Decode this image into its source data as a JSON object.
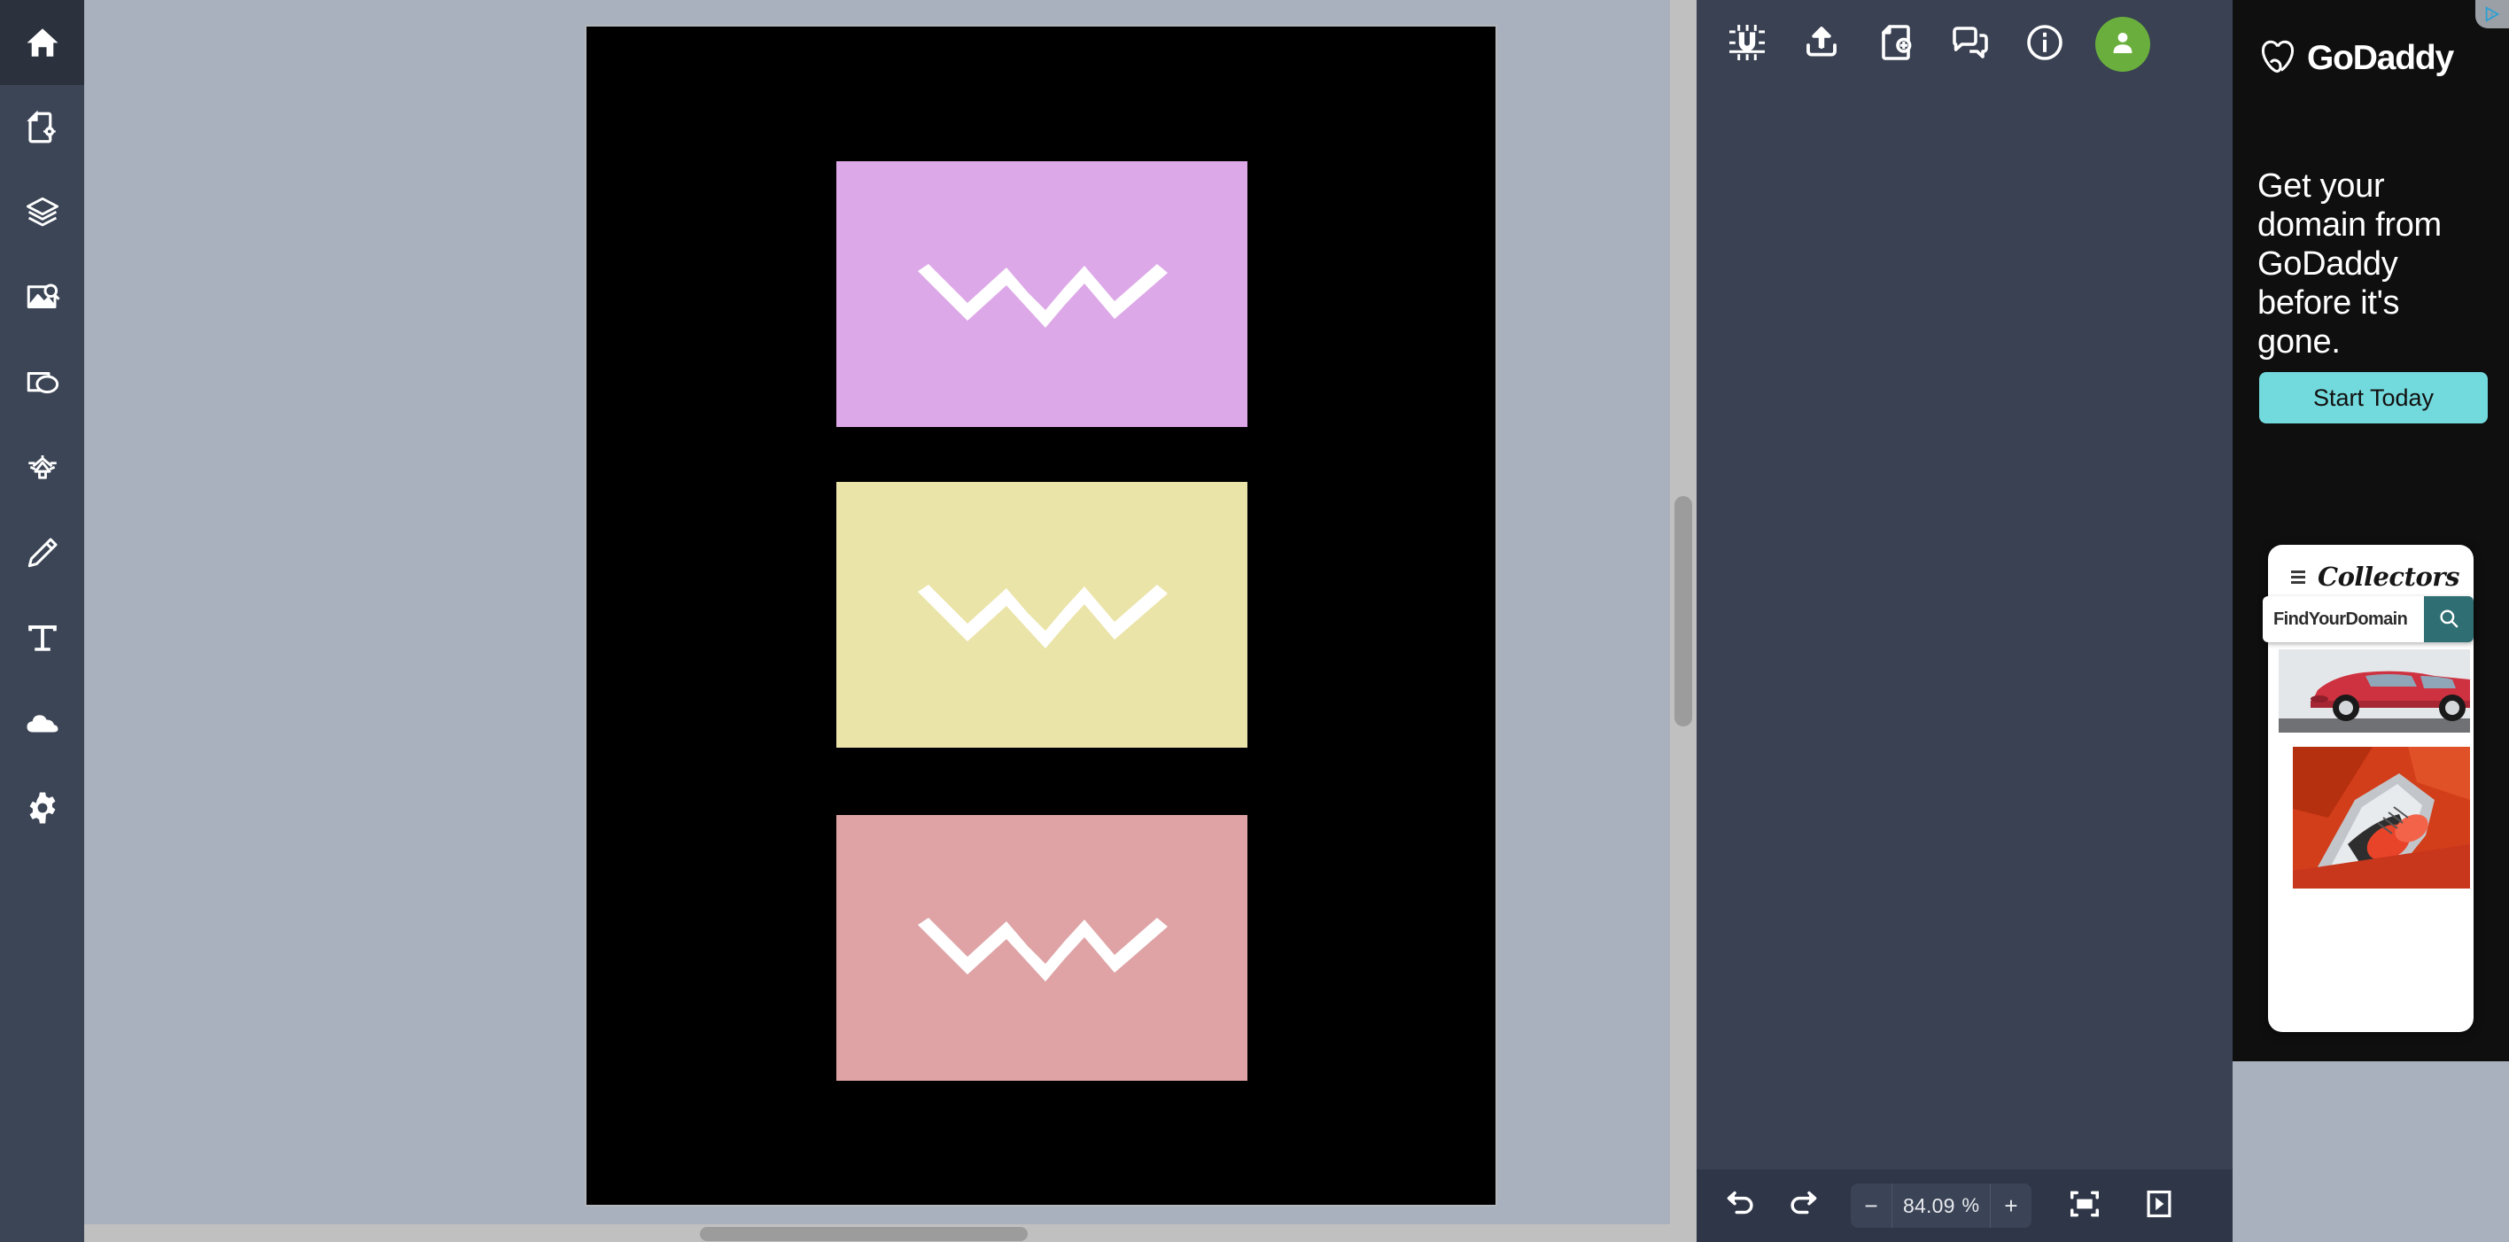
{
  "sidebar": {
    "items": [
      {
        "name": "home",
        "icon": "home-icon",
        "active": true
      },
      {
        "name": "page-setup",
        "icon": "document-settings-icon",
        "active": false
      },
      {
        "name": "layers",
        "icon": "layers-icon",
        "active": false
      },
      {
        "name": "images",
        "icon": "image-search-icon",
        "active": false
      },
      {
        "name": "shapes",
        "icon": "shapes-icon",
        "active": false
      },
      {
        "name": "drawing-tools",
        "icon": "vector-pen-icon",
        "active": false
      },
      {
        "name": "pencil",
        "icon": "pencil-icon",
        "active": false
      },
      {
        "name": "text",
        "icon": "text-tool-icon",
        "active": false
      },
      {
        "name": "uploads",
        "icon": "cloud-upload-icon",
        "active": false
      },
      {
        "name": "settings",
        "icon": "gear-icon",
        "active": false
      }
    ]
  },
  "toolbar": {
    "buttons": [
      {
        "name": "snap-to-grid",
        "icon": "magnet-grid-icon"
      },
      {
        "name": "upload",
        "icon": "upload-icon"
      },
      {
        "name": "add-page",
        "icon": "add-page-icon"
      },
      {
        "name": "comments",
        "icon": "comments-icon"
      },
      {
        "name": "info",
        "icon": "info-icon"
      }
    ],
    "avatar": {
      "name": "user-avatar",
      "icon": "person-icon",
      "color": "#6AAF3D"
    }
  },
  "bottom_bar": {
    "undo": {
      "name": "undo",
      "icon": "undo-arrow-icon"
    },
    "redo": {
      "name": "redo",
      "icon": "redo-arrow-icon"
    },
    "zoom_out_label": "−",
    "zoom_value": "84.09",
    "zoom_unit": "%",
    "zoom_in_label": "+",
    "fit_screen": {
      "name": "fit-to-screen",
      "icon": "fit-screen-icon"
    },
    "toggle_panel": {
      "name": "toggle-side-panel",
      "icon": "panel-toggle-icon"
    }
  },
  "canvas": {
    "background": "#000000",
    "blocks": [
      {
        "name": "block-purple",
        "color": "#DDA8E8",
        "logo": "zigzag-logo"
      },
      {
        "name": "block-yellow",
        "color": "#EBE4A8",
        "logo": "zigzag-logo"
      },
      {
        "name": "block-pink",
        "color": "#DFA3A6",
        "logo": "zigzag-logo"
      }
    ]
  },
  "ad": {
    "adchoices_icon": "adchoices-icon",
    "brand": "GoDaddy",
    "logo_icon": "godaddy-heart-logo-icon",
    "headline": "Get your domain from GoDaddy before it's gone.",
    "cta_label": "Start Today",
    "cta_color": "#72D9DD",
    "phone": {
      "menu_icon": "hamburger-menu-icon",
      "site_title": "Collectors",
      "search_value": "FindYourDomain",
      "search_icon": "magnifier-icon",
      "search_button_color": "#2F6F74",
      "images": [
        {
          "name": "red-classic-porsche-photo"
        },
        {
          "name": "vintage-car-tailfin-photo"
        }
      ]
    }
  }
}
